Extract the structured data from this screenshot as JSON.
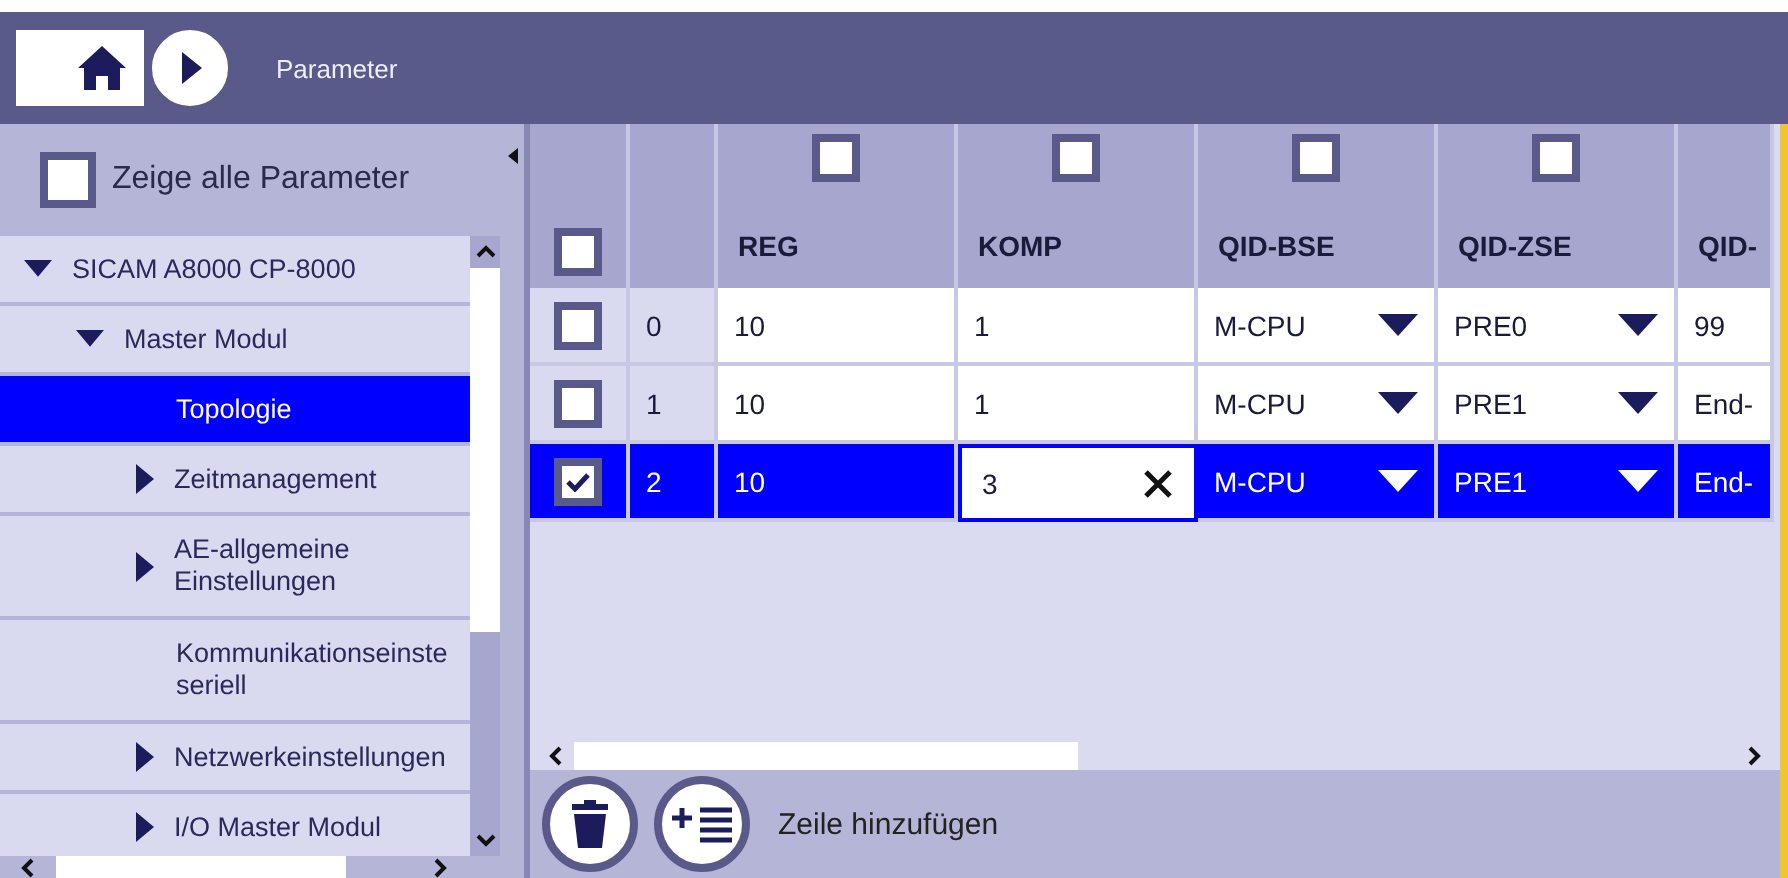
{
  "topbar": {
    "title": "Parameter"
  },
  "sidebar": {
    "show_all": {
      "label": "Zeige alle Parameter",
      "checked": false
    },
    "tree": [
      {
        "label": "SICAM A8000 CP-8000",
        "kind": "folder",
        "expanded": true,
        "selected": false,
        "children": [
          {
            "label": "Master Modul",
            "kind": "folder",
            "expanded": true,
            "selected": false,
            "children": [
              {
                "label": "Topologie",
                "kind": "leaf",
                "selected": true
              },
              {
                "label": "Zeitmanagement",
                "kind": "folder",
                "expanded": false,
                "selected": false
              },
              {
                "label": "AE-allgemeine Einstellungen",
                "kind": "folder",
                "expanded": false,
                "selected": false
              },
              {
                "label": "Kommunikationseinste seriell",
                "kind": "leaf",
                "selected": false
              },
              {
                "label": "Netzwerkeinstellungen",
                "kind": "folder",
                "expanded": false,
                "selected": false
              },
              {
                "label": "I/O Master Modul",
                "kind": "folder",
                "expanded": false,
                "selected": false
              }
            ]
          }
        ]
      }
    ]
  },
  "table": {
    "select_all": {
      "checked": false
    },
    "columns": [
      {
        "label": "REG",
        "kind": "text",
        "filter_checked": false
      },
      {
        "label": "KOMP",
        "kind": "text",
        "filter_checked": false
      },
      {
        "label": "QID-BSE",
        "kind": "dropdown",
        "filter_checked": false
      },
      {
        "label": "QID-ZSE",
        "kind": "dropdown",
        "filter_checked": false
      },
      {
        "label": "QID-",
        "kind": "text"
      }
    ],
    "rows": [
      {
        "index": "0",
        "checked": false,
        "selected": false,
        "cells": [
          {
            "value": "10",
            "editing": false
          },
          {
            "value": "1",
            "editing": false
          },
          {
            "value": "M-CPU",
            "editing": false
          },
          {
            "value": "PRE0",
            "editing": false
          },
          {
            "value": "99",
            "editing": false
          }
        ]
      },
      {
        "index": "1",
        "checked": false,
        "selected": false,
        "cells": [
          {
            "value": "10",
            "editing": false
          },
          {
            "value": "1",
            "editing": false
          },
          {
            "value": "M-CPU",
            "editing": false
          },
          {
            "value": "PRE1",
            "editing": false
          },
          {
            "value": "End-",
            "editing": false
          }
        ]
      },
      {
        "index": "2",
        "checked": true,
        "selected": true,
        "cells": [
          {
            "value": "10",
            "editing": false
          },
          {
            "value": "3",
            "editing": true
          },
          {
            "value": "M-CPU",
            "editing": false
          },
          {
            "value": "PRE1",
            "editing": false
          },
          {
            "value": "End-",
            "editing": false
          }
        ]
      }
    ]
  },
  "bottom_bar": {
    "add_row_label": "Zeile hinzufügen"
  }
}
